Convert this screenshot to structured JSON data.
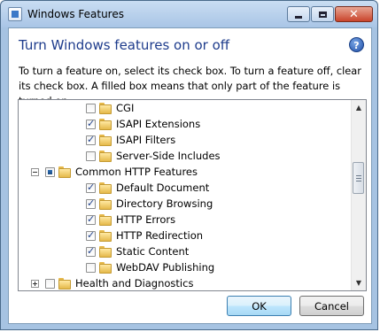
{
  "window": {
    "title": "Windows Features",
    "min_glyph": "",
    "close_glyph": "✕"
  },
  "dialog": {
    "heading": "Turn Windows features on or off",
    "help_glyph": "?",
    "description": "To turn a feature on, select its check box. To turn a feature off, clear its check box. A filled box means that only part of the feature is turned on."
  },
  "tree": {
    "items": [
      {
        "label": "CGI",
        "state": "unchecked",
        "indent": 2
      },
      {
        "label": "ISAPI Extensions",
        "state": "checked",
        "indent": 2
      },
      {
        "label": "ISAPI Filters",
        "state": "checked",
        "indent": 2
      },
      {
        "label": "Server-Side Includes",
        "state": "unchecked",
        "indent": 2
      },
      {
        "label": "Common HTTP Features",
        "state": "partial",
        "indent": 1,
        "expander": "minus"
      },
      {
        "label": "Default Document",
        "state": "checked",
        "indent": 2
      },
      {
        "label": "Directory Browsing",
        "state": "checked",
        "indent": 2
      },
      {
        "label": "HTTP Errors",
        "state": "checked",
        "indent": 2
      },
      {
        "label": "HTTP Redirection",
        "state": "checked",
        "indent": 2
      },
      {
        "label": "Static Content",
        "state": "checked",
        "indent": 2
      },
      {
        "label": "WebDAV Publishing",
        "state": "unchecked",
        "indent": 2
      },
      {
        "label": "Health and Diagnostics",
        "state": "unchecked",
        "indent": 1,
        "expander": "plus"
      }
    ],
    "scroll_up_glyph": "▲",
    "scroll_down_glyph": "▼"
  },
  "buttons": {
    "ok": "OK",
    "cancel": "Cancel"
  }
}
